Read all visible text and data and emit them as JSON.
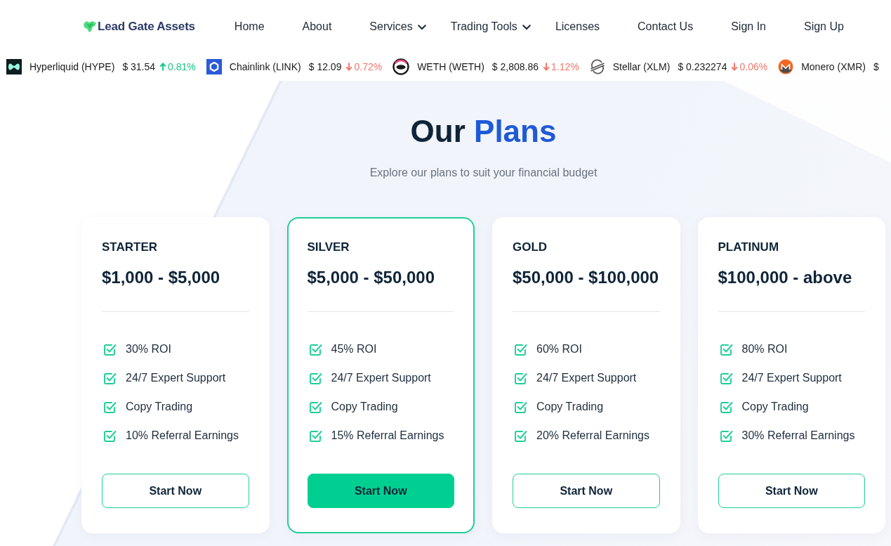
{
  "header": {
    "logo": {
      "text": "Lead Gate Assets"
    },
    "nav": [
      {
        "label": "Home",
        "has_menu": false
      },
      {
        "label": "About",
        "has_menu": false
      },
      {
        "label": "Services",
        "has_menu": true
      },
      {
        "label": "Trading Tools",
        "has_menu": true
      },
      {
        "label": "Licenses",
        "has_menu": false
      },
      {
        "label": "Contact Us",
        "has_menu": false
      },
      {
        "label": "Sign In",
        "has_menu": false
      },
      {
        "label": "Sign Up",
        "has_menu": false
      }
    ]
  },
  "ticker": [
    {
      "kind": "blob",
      "name": "Hyperliquid (HYPE)",
      "price": "$ 31.54",
      "change": "0.81%",
      "rising": true
    },
    {
      "kind": "hexagon",
      "name": "Chainlink (LINK)",
      "price": "$ 12.09",
      "change": "0.72%",
      "rising": false
    },
    {
      "kind": "ring",
      "name": "WETH (WETH)",
      "price": "$ 2,808.86",
      "change": "1.12%",
      "rising": false
    },
    {
      "kind": "swoosh",
      "name": "Stellar (XLM)",
      "price": "$ 0.232274",
      "change": "0.06%",
      "rising": false
    },
    {
      "kind": "disc",
      "name": "Monero (XMR)",
      "price": "$"
    }
  ],
  "plans_section": {
    "title": {
      "text": "Our",
      "highlight": "Plans"
    },
    "subtitle": "Explore our plans to suit your financial budget",
    "plans": [
      {
        "name": "STARTER",
        "price": "$1,000 - $5,000",
        "selected": false,
        "features": [
          "30% ROI",
          "24/7 Expert Support",
          "Copy Trading",
          "10% Referral Earnings"
        ],
        "button": "Start Now"
      },
      {
        "name": "SILVER",
        "price": "$5,000 - $50,000",
        "selected": true,
        "features": [
          "45% ROI",
          "24/7 Expert Support",
          "Copy Trading",
          "15% Referral Earnings"
        ],
        "button": "Start Now"
      },
      {
        "name": "GOLD",
        "price": "$50,000 - $100,000",
        "selected": false,
        "features": [
          "60% ROI",
          "24/7 Expert Support",
          "Copy Trading",
          "20% Referral Earnings"
        ],
        "button": "Start Now"
      },
      {
        "name": "PLATINUM",
        "price": "$100,000 - above",
        "selected": false,
        "features": [
          "80% ROI",
          "24/7 Expert Support",
          "Copy Trading",
          "30% Referral Earnings"
        ],
        "button": "Start Now"
      }
    ]
  }
}
